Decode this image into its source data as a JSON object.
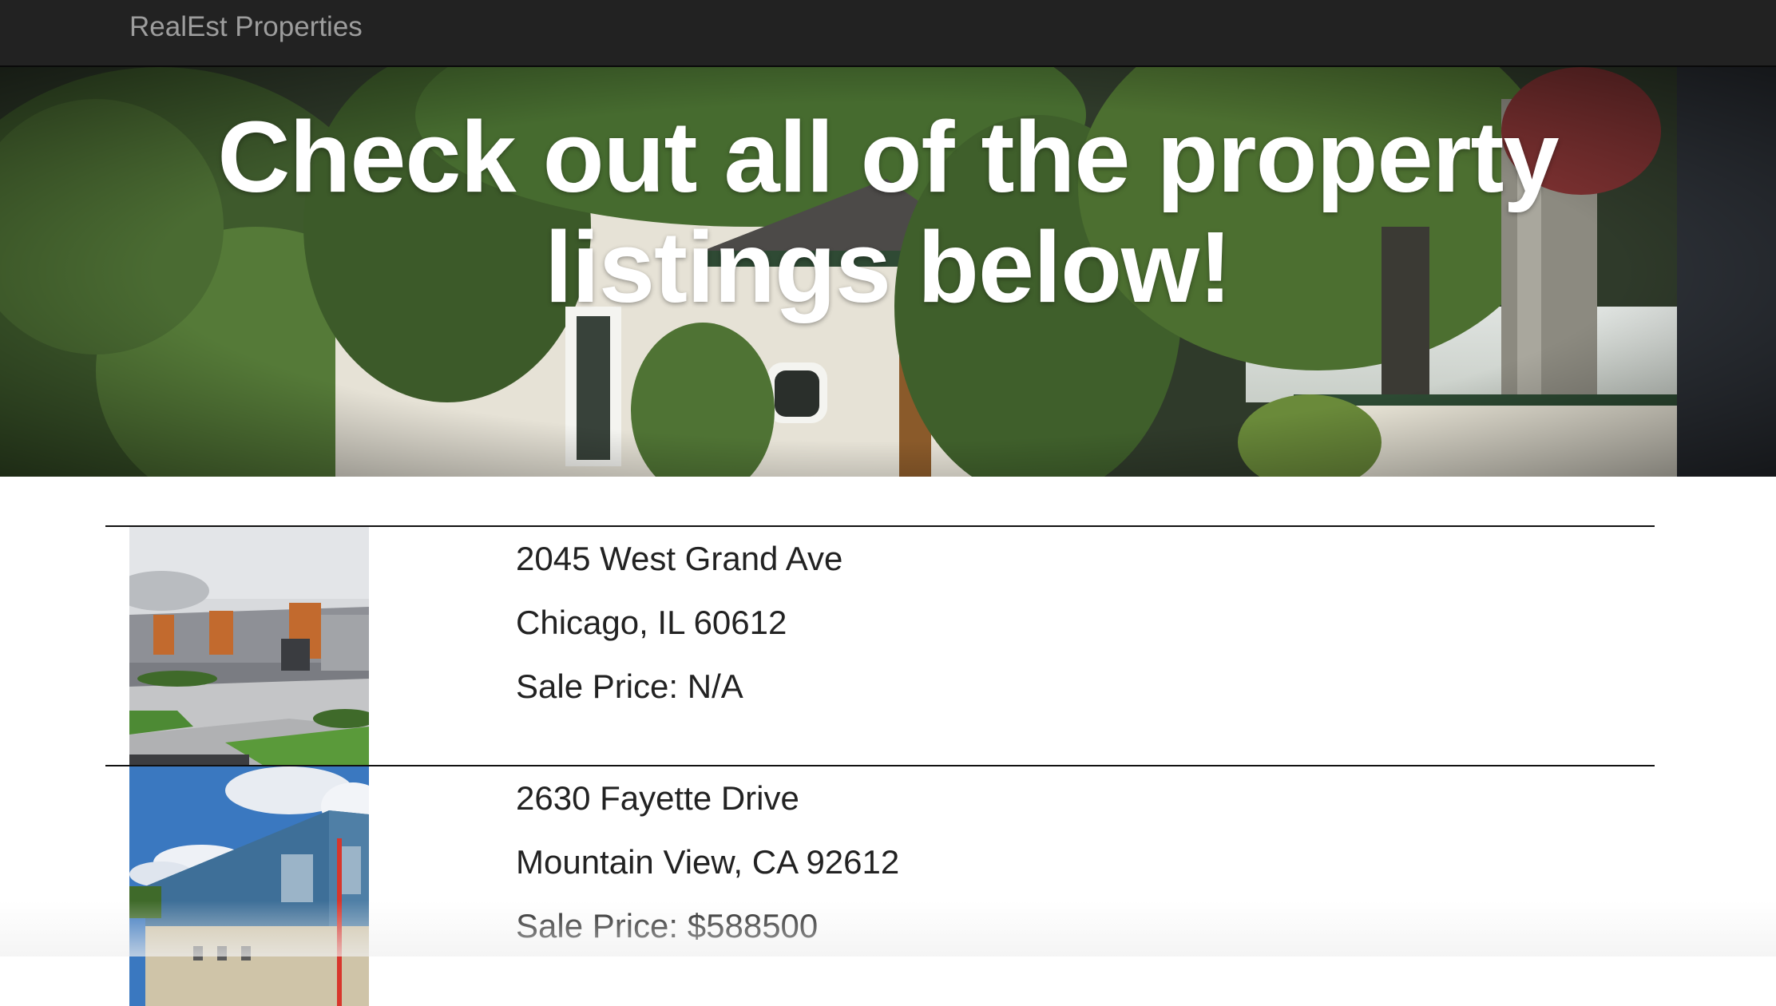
{
  "navbar": {
    "brand": "RealEst Properties"
  },
  "hero": {
    "title_line1": "Check out all of the property",
    "title_line2": "listings below!",
    "image": "house-with-ivy-photo"
  },
  "listings": [
    {
      "address": "2045 West Grand Ave",
      "city_state_zip": "Chicago, IL 60612",
      "price": "Sale Price: N/A",
      "image": "modern-industrial-building-photo"
    },
    {
      "address": "2630 Fayette Drive",
      "city_state_zip": "Mountain View, CA 92612",
      "price": "Sale Price: $588500",
      "image": "blue-warehouse-building-photo"
    }
  ],
  "colors": {
    "navbar_bg": "#222222",
    "brand_text": "#9d9d9d",
    "hero_text": "#ffffff",
    "body_text": "#222222"
  }
}
